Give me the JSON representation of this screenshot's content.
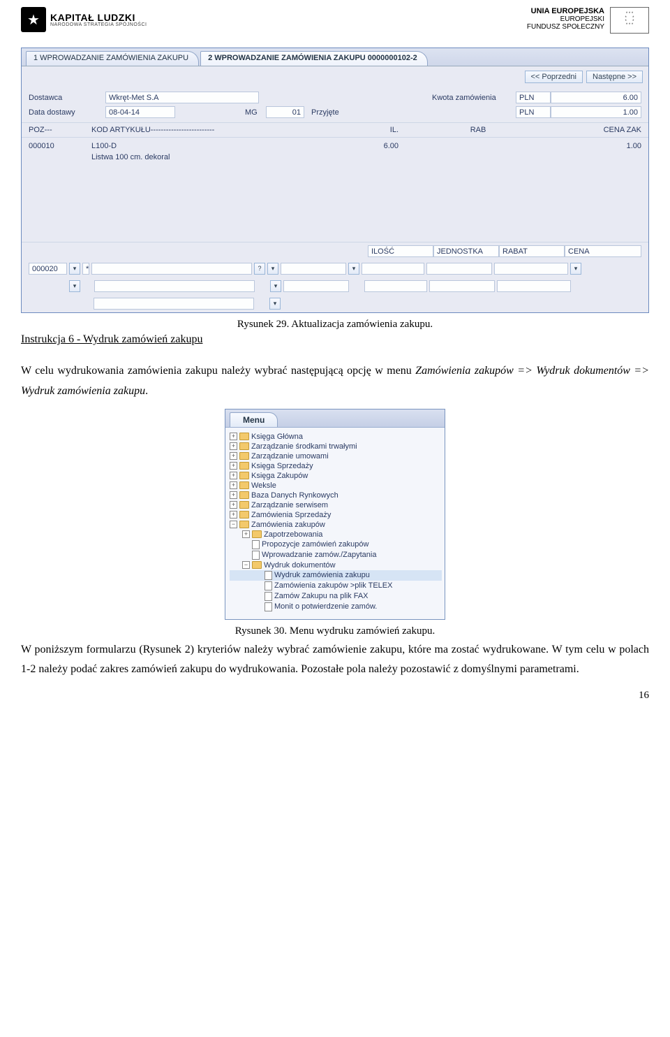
{
  "header": {
    "kl_big": "KAPITAŁ LUDZKI",
    "kl_small": "NARODOWA STRATEGIA SPÓJNOŚCI",
    "eu_line1": "UNIA EUROPEJSKA",
    "eu_line2": "EUROPEJSKI",
    "eu_line3": "FUNDUSZ SPOŁECZNY"
  },
  "shot1": {
    "tab1": "1 WPROWADZANIE ZAMÓWIENIA ZAKUPU",
    "tab2": "2 WPROWADZANIE ZAMÓWIENIA ZAKUPU 0000000102-2",
    "prev_btn": "<< Poprzedni",
    "next_btn": "Następne >>",
    "row1": {
      "label_dostawca": "Dostawca",
      "val_dostawca": "Wkręt-Met S.A",
      "label_kwota": "Kwota zamówienia",
      "val_pln1": "PLN",
      "val_amount": "6.00"
    },
    "row2": {
      "label_data": "Data dostawy",
      "val_data": "08-04-14",
      "label_mg": "MG",
      "val_mg": "01",
      "label_przy": "Przyjęte",
      "val_pln2": "PLN",
      "val_amount2": "1.00"
    },
    "cols": {
      "poz": "POZ---",
      "kod": "KOD ARTYKUŁU-------------------------",
      "il": "IL.",
      "rab": "RAB",
      "cena": "CENA ZAK"
    },
    "data": {
      "poz": "000010",
      "kod": "L100-D",
      "desc": "Listwa 100 cm. dekoral",
      "il": "6.00",
      "cena": "1.00"
    },
    "bottom": {
      "h_ilosc": "ILOŚĆ",
      "h_jedn": "JEDNOSTKA",
      "h_rabat": "RABAT",
      "h_cena": "CENA",
      "entry_num": "000020",
      "entry_star": "*",
      "q_mark": "?"
    }
  },
  "caption1": "Rysunek 29. Aktualizacja zamówienia zakupu.",
  "section_link": "Instrukcja 6 - Wydruk zamówień zakupu",
  "para1_a": "W celu wydrukowania  zamówienia zakupu należy wybrać następującą opcję w menu ",
  "para1_b": "Zamówienia zakupów => Wydruk dokumentów => Wydruk zamówienia zakupu",
  "para1_c": ".",
  "menu": {
    "tab": "Menu",
    "items": [
      "Księga Główna",
      "Zarządzanie środkami trwałymi",
      "Zarządzanie umowami",
      "Księga Sprzedaży",
      "Księga Zakupów",
      "Weksle",
      "Baza Danych Rynkowych",
      "Zarządzanie serwisem",
      "Zamówienia Sprzedaży",
      "Zamówienia zakupów"
    ],
    "sub1": "Zapotrzebowania",
    "sub2": "Propozycje zamówień zakupów",
    "sub3": "Wprowadzanie zamów./Zapytania",
    "sub4": "Wydruk dokumentów",
    "leaf1": "Wydruk zamówienia zakupu",
    "leaf2": "Zamówienia zakupów >plik TELEX",
    "leaf3": "Zamów Zakupu na plik FAX",
    "leaf4": "Monit o potwierdzenie zamów."
  },
  "caption2": "Rysunek 30. Menu wydruku zamówień zakupu.",
  "para2": "W poniższym formularzu (Rysunek 2) kryteriów należy wybrać zamówienie zakupu, które ma zostać wydrukowane. W tym celu w polach 1-2 należy podać zakres zamówień zakupu do wydrukowania. Pozostałe pola należy pozostawić z domyślnymi parametrami.",
  "page_num": "16"
}
